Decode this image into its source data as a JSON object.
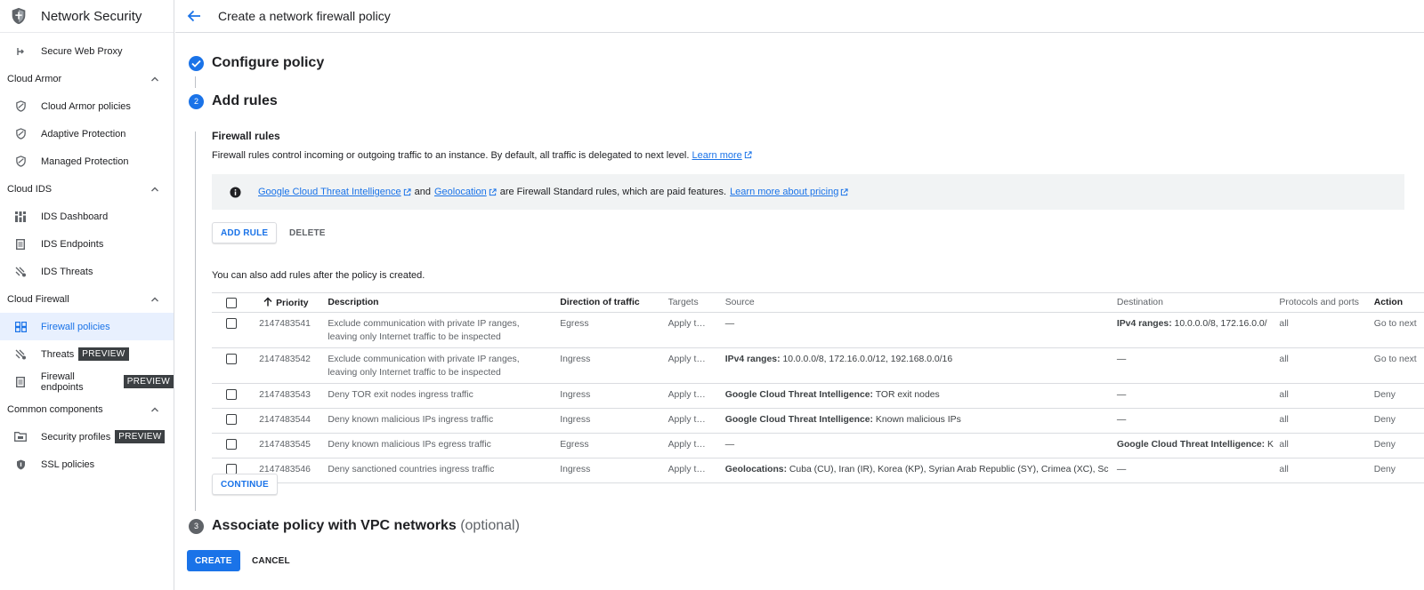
{
  "app": {
    "title": "Network Security",
    "logo_icon": "shield-icon"
  },
  "header": {
    "title": "Create a network firewall policy",
    "back_icon": "arrow-back-icon"
  },
  "sidebar": {
    "top_items": [
      {
        "label": "Secure Web Proxy",
        "icon": "proxy-icon"
      }
    ],
    "sections": [
      {
        "label": "Cloud Armor",
        "items": [
          {
            "label": "Cloud Armor policies",
            "icon": "shield-icon"
          },
          {
            "label": "Adaptive Protection",
            "icon": "shield-icon"
          },
          {
            "label": "Managed Protection",
            "icon": "shield-icon"
          }
        ]
      },
      {
        "label": "Cloud IDS",
        "items": [
          {
            "label": "IDS Dashboard",
            "icon": "dashboard-icon"
          },
          {
            "label": "IDS Endpoints",
            "icon": "list-icon"
          },
          {
            "label": "IDS Threats",
            "icon": "threats-icon"
          }
        ]
      },
      {
        "label": "Cloud Firewall",
        "items": [
          {
            "label": "Firewall policies",
            "icon": "grid-icon",
            "active": true
          },
          {
            "label": "Threats",
            "icon": "threats-icon",
            "badge": "PREVIEW"
          },
          {
            "label": "Firewall endpoints",
            "icon": "list-icon",
            "badge": "PREVIEW"
          }
        ]
      },
      {
        "label": "Common components",
        "items": [
          {
            "label": "Security profiles",
            "icon": "folder-icon",
            "badge": "PREVIEW"
          },
          {
            "label": "SSL policies",
            "icon": "shield-icon"
          }
        ]
      }
    ]
  },
  "steps": [
    {
      "number": "✓",
      "title": "Configure policy",
      "state": "done"
    },
    {
      "number": "2",
      "title": "Add rules",
      "state": "active"
    },
    {
      "number": "3",
      "title": "Associate policy with VPC networks",
      "optional": "(optional)",
      "state": "pending"
    }
  ],
  "firewall_rules": {
    "title": "Firewall rules",
    "description": "Firewall rules control incoming or outgoing traffic to an instance. By default, all traffic is delegated to next level.",
    "learn_more": "Learn more"
  },
  "info": {
    "link1": "Google Cloud Threat Intelligence",
    "and_text": "and",
    "link2": "Geolocation",
    "text": "are Firewall Standard rules, which are paid features.",
    "link3": "Learn more about pricing"
  },
  "buttons": {
    "add_rule": "ADD RULE",
    "delete": "DELETE",
    "continue": "CONTINUE",
    "create": "CREATE",
    "cancel": "CANCEL"
  },
  "hint": "You can also add rules after the policy is created.",
  "table": {
    "columns": [
      "Priority",
      "Description",
      "Direction of traffic",
      "Targets",
      "Source",
      "Destination",
      "Protocols and ports",
      "Action"
    ],
    "rows": [
      {
        "priority": "2147483541",
        "desc1": "Exclude communication with private IP ranges,",
        "desc2": "leaving only Internet traffic to be inspected",
        "direction": "Egress",
        "targets": "Apply t…",
        "source_label": "",
        "source": "—",
        "dest_label": "IPv4 ranges:",
        "dest": "10.0.0.0/8, 172.16.0.0/",
        "protocols": "all",
        "action": "Go to next"
      },
      {
        "priority": "2147483542",
        "desc1": "Exclude communication with private IP ranges,",
        "desc2": "leaving only Internet traffic to be inspected",
        "direction": "Ingress",
        "targets": "Apply t…",
        "source_label": "IPv4 ranges:",
        "source": "10.0.0.0/8, 172.16.0.0/12, 192.168.0.0/16",
        "dest_label": "",
        "dest": "—",
        "protocols": "all",
        "action": "Go to next"
      },
      {
        "priority": "2147483543",
        "desc1": "Deny TOR exit nodes ingress traffic",
        "desc2": "",
        "direction": "Ingress",
        "targets": "Apply t…",
        "source_label": "Google Cloud Threat Intelligence:",
        "source": "TOR exit nodes",
        "dest_label": "",
        "dest": "—",
        "protocols": "all",
        "action": "Deny"
      },
      {
        "priority": "2147483544",
        "desc1": "Deny known malicious IPs ingress traffic",
        "desc2": "",
        "direction": "Ingress",
        "targets": "Apply t…",
        "source_label": "Google Cloud Threat Intelligence:",
        "source": "Known malicious IPs",
        "dest_label": "",
        "dest": "—",
        "protocols": "all",
        "action": "Deny"
      },
      {
        "priority": "2147483545",
        "desc1": "Deny known malicious IPs egress traffic",
        "desc2": "",
        "direction": "Egress",
        "targets": "Apply t…",
        "source_label": "",
        "source": "—",
        "dest_label": "Google Cloud Threat Intelligence:",
        "dest": "K",
        "protocols": "all",
        "action": "Deny"
      },
      {
        "priority": "2147483546",
        "desc1": "Deny sanctioned countries ingress traffic",
        "desc2": "",
        "direction": "Ingress",
        "targets": "Apply t…",
        "source_label": "Geolocations:",
        "source": "Cuba (CU), Iran (IR), Korea (KP), Syrian Arab Republic (SY), Crimea (XC), Sc",
        "dest_label": "",
        "dest": "—",
        "protocols": "all",
        "action": "Deny"
      }
    ]
  },
  "colors": {
    "accent": "#1a73e8",
    "active_bg": "#e8f0fe",
    "info_bg": "#f1f3f4",
    "step_pending": "#5f6368"
  }
}
